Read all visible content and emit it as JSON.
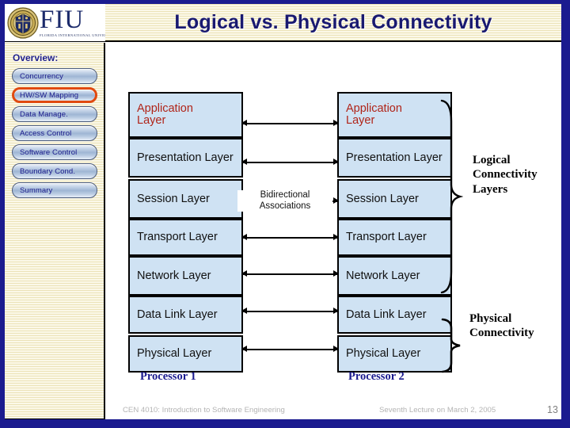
{
  "slide": {
    "title": "Logical vs. Physical Connectivity",
    "page_number": "13",
    "accent_navy": "#1b1b8f",
    "layer_fill": "#cfe2f3",
    "highlight_orange": "#e04a10",
    "red_text": "#b02418"
  },
  "logo": {
    "acronym": "FIU",
    "subtitle": "FLORIDA INTERNATIONAL UNIVERSITY",
    "seal_name": "fiu-seal-icon"
  },
  "sidebar": {
    "heading": "Overview:",
    "items": [
      {
        "label": "Concurrency",
        "active": false
      },
      {
        "label": "HW/SW Mapping",
        "active": true
      },
      {
        "label": "Data Manage.",
        "active": false
      },
      {
        "label": "Access Control",
        "active": false
      },
      {
        "label": "Software Control",
        "active": false
      },
      {
        "label": "Boundary Cond.",
        "active": false
      },
      {
        "label": "Summary",
        "active": false
      }
    ]
  },
  "diagram": {
    "left_stack": {
      "caption": "Processor 1",
      "layers": [
        {
          "label": "Application Layer",
          "red": true
        },
        {
          "label": "Presentation Layer",
          "red": false
        },
        {
          "label": "Session Layer",
          "red": false
        },
        {
          "label": "Transport Layer",
          "red": false
        },
        {
          "label": "Network Layer",
          "red": false
        },
        {
          "label": "Data Link Layer",
          "red": false
        },
        {
          "label": "Physical Layer",
          "red": false
        }
      ]
    },
    "right_stack": {
      "caption": "Processor 2",
      "layers": [
        {
          "label": "Application Layer",
          "red": true
        },
        {
          "label": "Presentation Layer",
          "red": false
        },
        {
          "label": "Session Layer",
          "red": false
        },
        {
          "label": "Transport Layer",
          "red": false
        },
        {
          "label": "Network Layer",
          "red": false
        },
        {
          "label": "Data Link Layer",
          "red": false
        },
        {
          "label": "Physical Layer",
          "red": false
        }
      ]
    },
    "association_caption_line1": "Bidirectional",
    "association_caption_line2": "Associations",
    "logical_brace_caption": "Logical Connectivity Layers",
    "physical_brace_caption": "Physical Connectivity"
  },
  "footer": {
    "course": "CEN 4010: Introduction to Software Engineering",
    "lecture": "Seventh Lecture on March 2, 2005",
    "page": "13"
  }
}
